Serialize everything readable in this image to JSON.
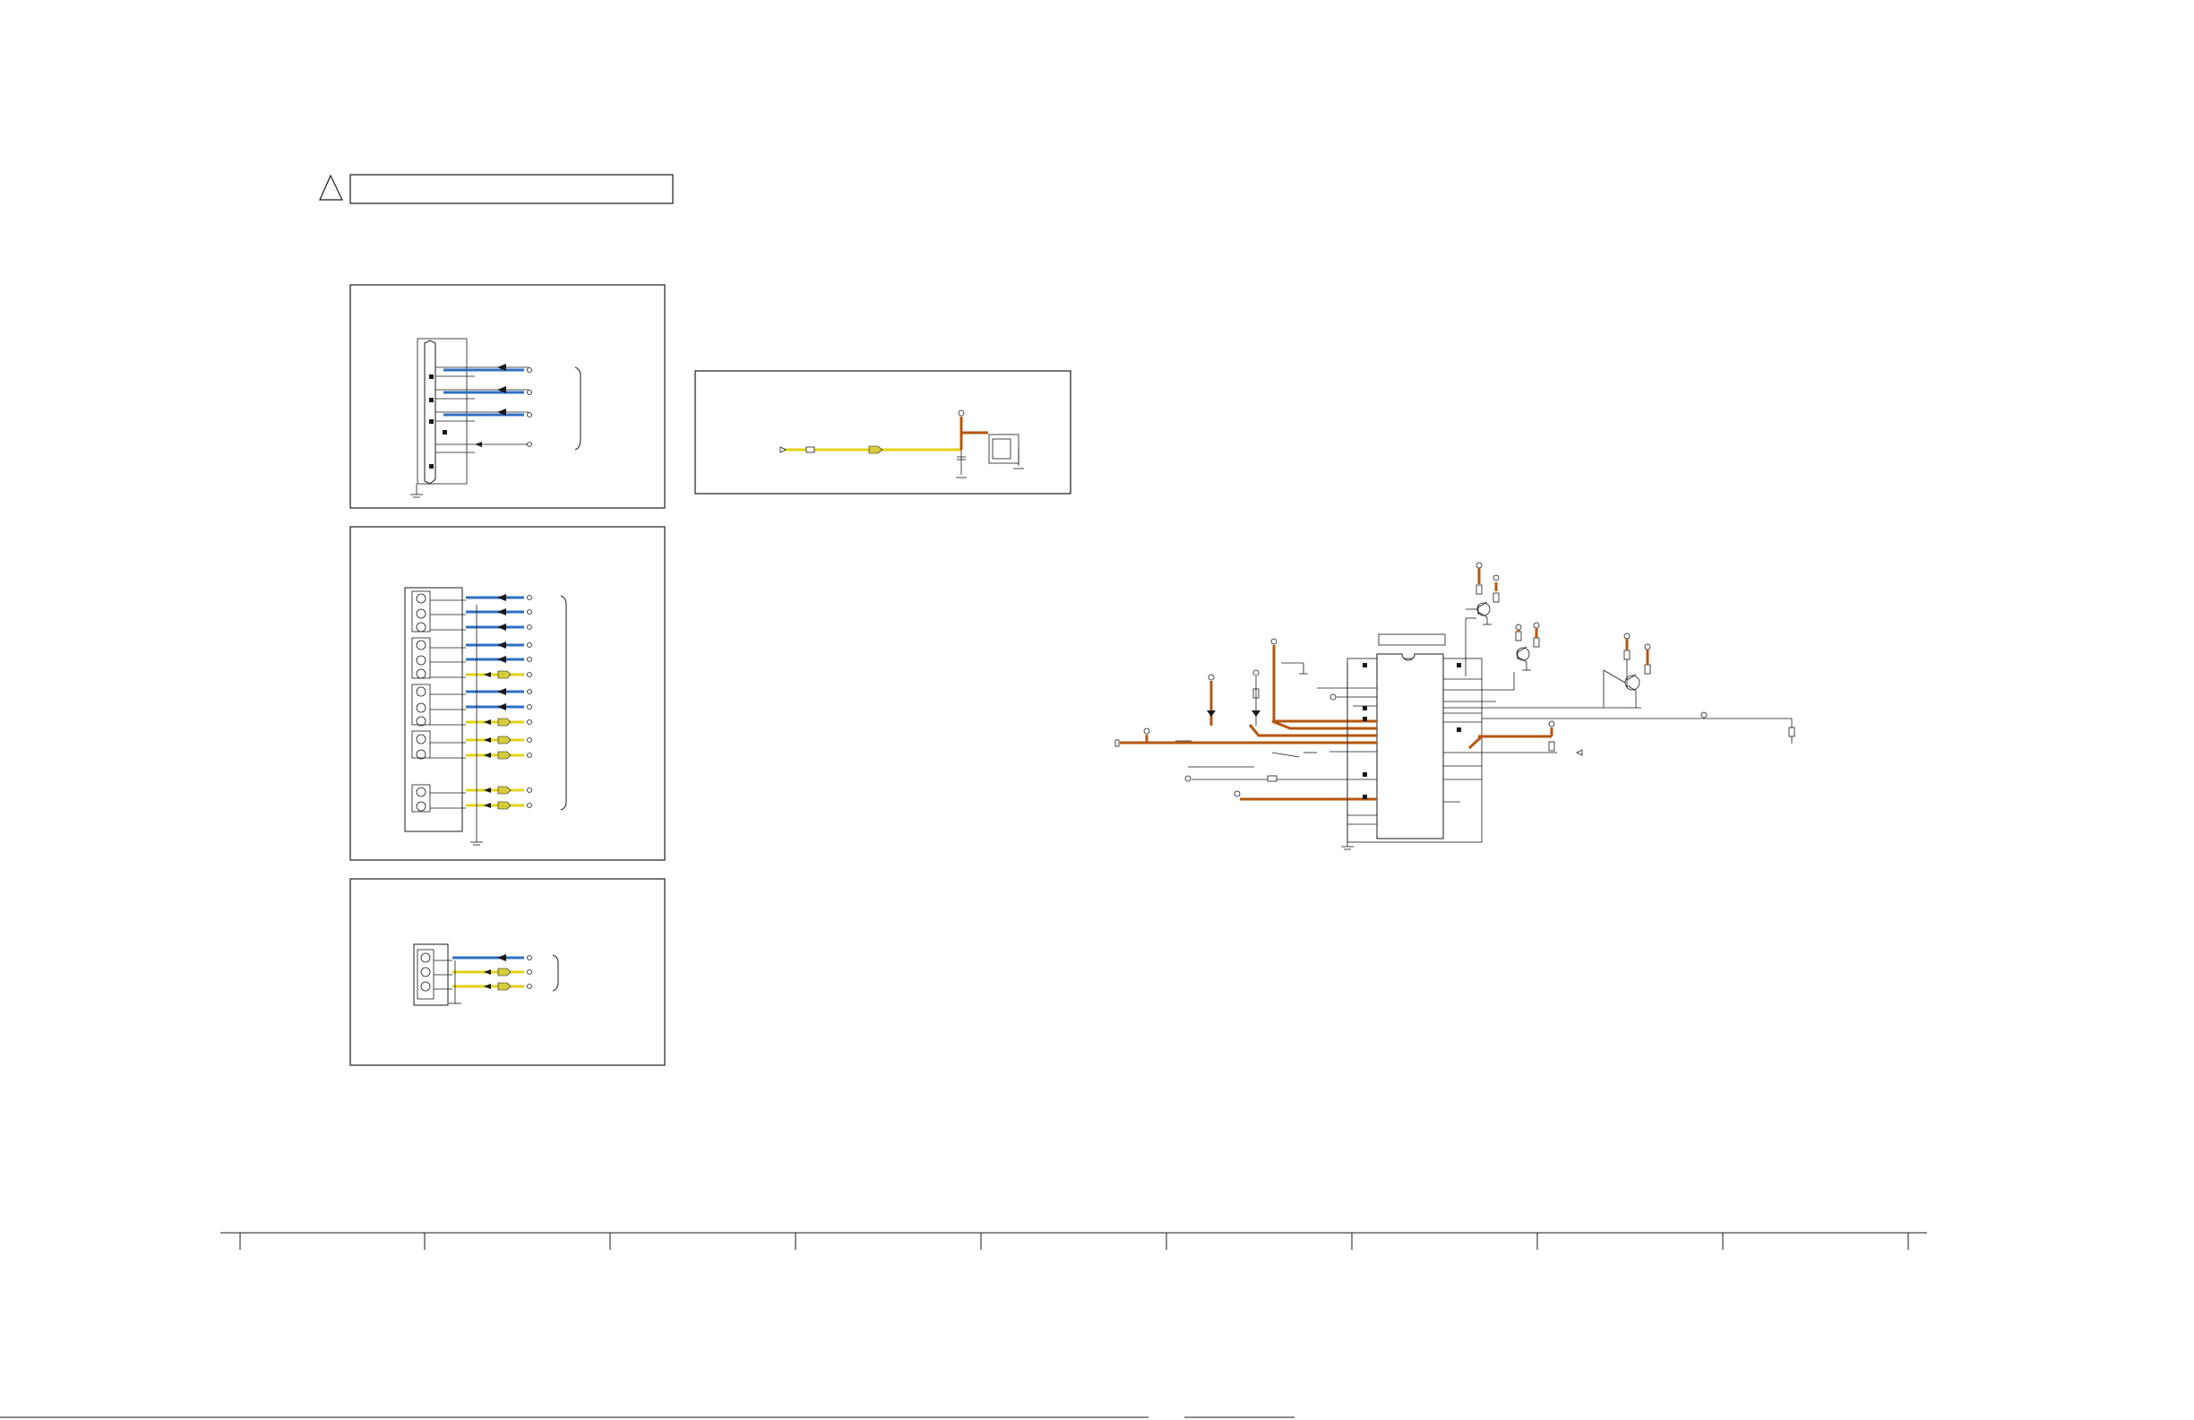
{
  "palette": {
    "line": "#1a1a1a",
    "video": "#2e6fc1",
    "audio": "#e2d31a",
    "power": "#b5570f",
    "background": "#ffffff"
  },
  "warning": {
    "icon": "warning-triangle-icon",
    "text": ""
  },
  "title_block": {
    "text": ""
  },
  "icons": {
    "connector": "connector-icon",
    "ground": "ground-icon",
    "transistor": "transistor-icon",
    "resistor": "resistor-icon",
    "diode": "diode-icon",
    "capacitor": "capacitor-icon",
    "terminal": "terminal-icon"
  }
}
